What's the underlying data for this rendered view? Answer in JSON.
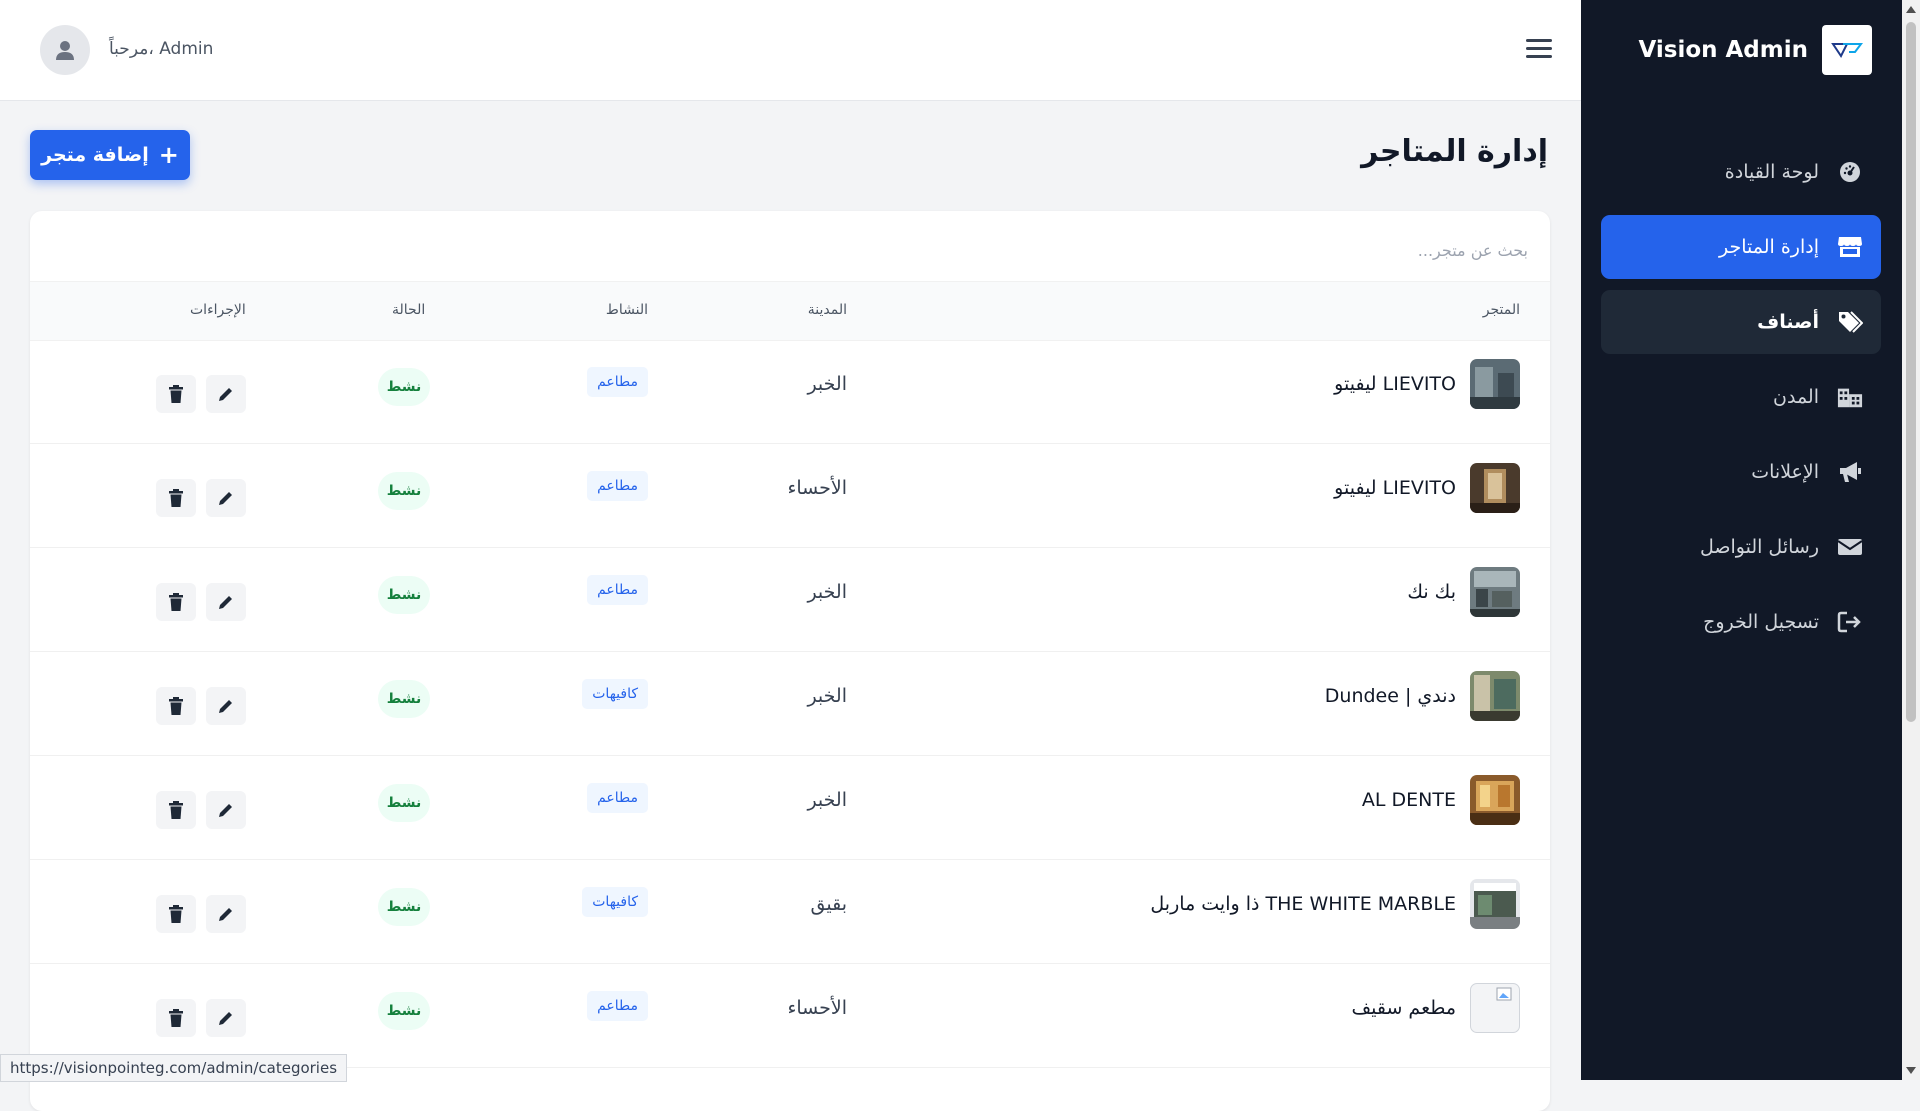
{
  "sidebar": {
    "brand_title": "Vision Admin",
    "nav": [
      {
        "label": "لوحة القيادة",
        "icon": "dashboard-icon"
      },
      {
        "label": "إدارة المتاجر",
        "icon": "store-icon",
        "state": "active"
      },
      {
        "label": "أصناف",
        "icon": "tags-icon",
        "state": "hover"
      },
      {
        "label": "المدن",
        "icon": "city-icon"
      },
      {
        "label": "الإعلانات",
        "icon": "megaphone-icon"
      },
      {
        "label": "رسائل التواصل",
        "icon": "envelope-icon"
      },
      {
        "label": "تسجيل الخروج",
        "icon": "logout-icon"
      }
    ]
  },
  "header": {
    "greeting": "مرحباً، Admin"
  },
  "page": {
    "title": "إدارة المتاجر",
    "add_button": "إضافة متجر"
  },
  "search": {
    "placeholder": "بحث عن متجر..."
  },
  "table": {
    "headers": {
      "store": "المتجر",
      "city": "المدينة",
      "activity": "النشاط",
      "status": "الحالة",
      "actions": "الإجراءات"
    },
    "rows": [
      {
        "name": "ليفيتو LIEVITO",
        "city": "الخبر",
        "activity": "مطاعم",
        "status": "نشط"
      },
      {
        "name": "ليفيتو LIEVITO",
        "city": "الأحساء",
        "activity": "مطاعم",
        "status": "نشط"
      },
      {
        "name": "بك نك",
        "city": "الخبر",
        "activity": "مطاعم",
        "status": "نشط"
      },
      {
        "name": "Dundee | دندي",
        "city": "الخبر",
        "activity": "كافيهات",
        "status": "نشط"
      },
      {
        "name": "AL DENTE",
        "city": "الخبر",
        "activity": "مطاعم",
        "status": "نشط"
      },
      {
        "name": "ذا وايت ماربل THE WHITE MARBLE",
        "city": "بقيق",
        "activity": "كافيهات",
        "status": "نشط"
      },
      {
        "name": "مطعم سقيف",
        "city": "الأحساء",
        "activity": "مطاعم",
        "status": "نشط"
      }
    ]
  },
  "statusbar": {
    "url": "https://visionpointeg.com/admin/categories"
  },
  "colors": {
    "accent": "#2563eb",
    "sidebar_bg": "#111827",
    "status_green": "#15803d"
  }
}
